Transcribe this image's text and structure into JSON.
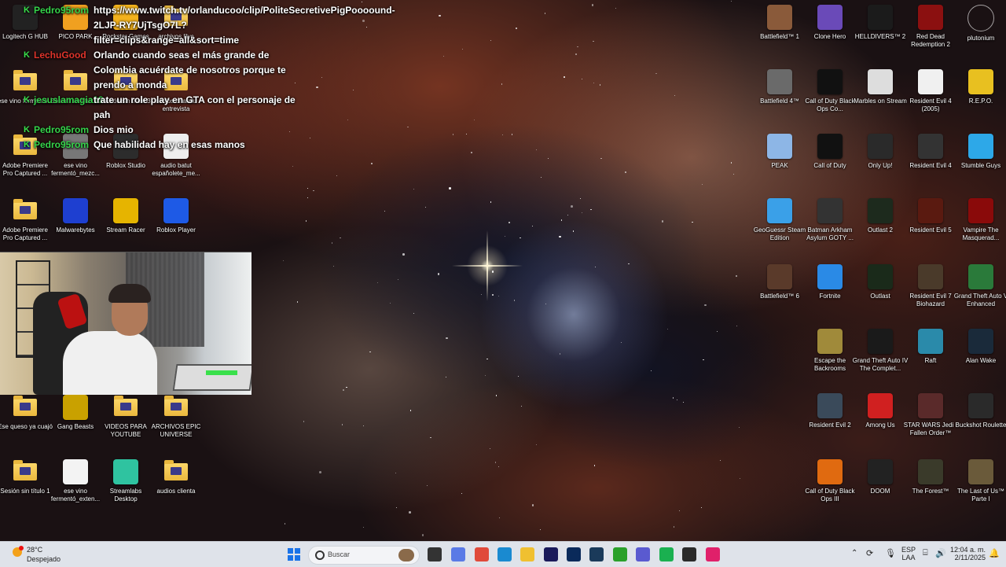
{
  "chat": [
    {
      "user": "Pedro95rom",
      "user_color": "#35d34a",
      "text": "https://www.twitch.tv/orlanducoo/clip/PoliteSecretivePigPoooound-2LJP-RY7UjTsgO7L?filter=clips&range=all&sort=time"
    },
    {
      "user": "LechuGood",
      "user_color": "#e0342b",
      "text": "Orlando cuando seas el más grande de Colombia acuérdate de nosotros porque te prendo a monda"
    },
    {
      "user": "jesuslamagia19",
      "user_color": "#35d34a",
      "text": "trate un role play en GTA con el personaje de pah"
    },
    {
      "user": "Pedro95rom",
      "user_color": "#35d34a",
      "text": "Dios mio"
    },
    {
      "user": "Pedro95rom",
      "user_color": "#35d34a",
      "text": "Que habilidad hay en esas manos"
    }
  ],
  "left_icons": [
    {
      "label": "Logitech G HUB",
      "color": "#222"
    },
    {
      "label": "PICO PARK",
      "color": "#f0a020"
    },
    {
      "label": "Rockstar Games",
      "color": "#f3b21d"
    },
    {
      "label": "archivos lilyc",
      "color": "folder"
    },
    {
      "label": "ese vino fermentó...",
      "color": "folder"
    },
    {
      "label": "Sesión sin título 2",
      "color": "folder"
    },
    {
      "label": "Sesión sin título 3",
      "color": "folder"
    },
    {
      "label": "audios orlandu entrevista",
      "color": "folder"
    },
    {
      "label": "Adobe Premiere Pro Captured ...",
      "color": "folder"
    },
    {
      "label": "ese vino fermentó_mezc...",
      "color": "#777"
    },
    {
      "label": "Roblox Studio",
      "color": "#2c2c2c"
    },
    {
      "label": "audio batut españolete_me...",
      "color": "#eee"
    },
    {
      "label": "Adobe Premiere Pro Captured ...",
      "color": "folder"
    },
    {
      "label": "Malwarebytes",
      "color": "#1e3fd0"
    },
    {
      "label": "Stream Racer",
      "color": "#e6b400"
    },
    {
      "label": "Roblox Player",
      "color": "#1e5ae6"
    },
    {
      "label": "Ese queso ya cuajó",
      "color": "folder"
    },
    {
      "label": "Gang Beasts",
      "color": "#c9a100"
    },
    {
      "label": "VIDEOS PARA YOUTUBE",
      "color": "folder"
    },
    {
      "label": "ARCHIVOS EPIC UNIVERSE",
      "color": "folder"
    },
    {
      "label": "Sesión sin título 1",
      "color": "folder"
    },
    {
      "label": "ese vino fermentó_exten...",
      "color": "#f3f3f3"
    },
    {
      "label": "Streamlabs Desktop",
      "color": "#2fc3a0"
    },
    {
      "label": "audios clienta",
      "color": "folder"
    }
  ],
  "right_icons": [
    {
      "label": "Battlefield™ 1",
      "color": "#8a5a3a"
    },
    {
      "label": "Clone Hero",
      "color": "#6a4ab8"
    },
    {
      "label": "HELLDIVERS™ 2",
      "color": "#1b1b1b"
    },
    {
      "label": "Red Dead Redemption 2",
      "color": "#8b1010"
    },
    {
      "label": "plutonium",
      "color": "transparent"
    },
    {
      "label": "Battlefield 4™",
      "color": "#6a6a6a"
    },
    {
      "label": "Call of Duty Black Ops Co...",
      "color": "#111"
    },
    {
      "label": "Marbles on Stream",
      "color": "#ddd"
    },
    {
      "label": "Resident Evil 4 (2005)",
      "color": "#f0f0f0"
    },
    {
      "label": "R.E.P.O.",
      "color": "#e8c020"
    },
    {
      "label": "PEAK",
      "color": "#8db6e6"
    },
    {
      "label": "Call of Duty",
      "color": "#111"
    },
    {
      "label": "Only Up!",
      "color": "#2a2a2a"
    },
    {
      "label": "Resident Evil 4",
      "color": "#333"
    },
    {
      "label": "Stumble Guys",
      "color": "#2da8e8"
    },
    {
      "label": "GeoGuessr Steam Edition",
      "color": "#3aa0e8"
    },
    {
      "label": "Batman Arkham Asylum GOTY ...",
      "color": "#333"
    },
    {
      "label": "Outlast 2",
      "color": "#1d2a1d"
    },
    {
      "label": "Resident Evil 5",
      "color": "#5a1a10"
    },
    {
      "label": "Vampire The Masquerad...",
      "color": "#8a0a0a"
    },
    {
      "label": "Battlefield™ 6",
      "color": "#5a3a2a"
    },
    {
      "label": "Fortnite",
      "color": "#2a8ae6"
    },
    {
      "label": "Outlast",
      "color": "#1a2a1a"
    },
    {
      "label": "Resident Evil 7 Biohazard",
      "color": "#4a3a2a"
    },
    {
      "label": "Grand Theft Auto V Enhanced",
      "color": "#2a7a3a"
    },
    {
      "label": "Escape the Backrooms",
      "color": "#a08a3a"
    },
    {
      "label": "Grand Theft Auto IV The Complet...",
      "color": "#1a1a1a"
    },
    {
      "label": "Raft",
      "color": "#2a8aaa"
    },
    {
      "label": "Alan Wake",
      "color": "#1a2a3a"
    },
    {
      "label": "Resident Evil 2",
      "color": "#3a4a5a"
    },
    {
      "label": "Among Us",
      "color": "#d02020"
    },
    {
      "label": "STAR WARS Jedi - Fallen Order™",
      "color": "#5a2a2a"
    },
    {
      "label": "Buckshot Roulette",
      "color": "#2a2a2a"
    },
    {
      "label": "Call of Duty Black Ops III",
      "color": "#e06a10"
    },
    {
      "label": "DOOM",
      "color": "#222"
    },
    {
      "label": "The Forest™",
      "color": "#3a3a2a"
    },
    {
      "label": "The Last of Us™ Parte I",
      "color": "#6a5a3a"
    }
  ],
  "taskbar": {
    "weather_temp": "28°C",
    "weather_desc": "Despejado",
    "search_placeholder": "Buscar",
    "language_line1": "ESP",
    "language_line2": "LAA",
    "time": "12:04 a. m.",
    "date": "2/11/2025",
    "apps": [
      {
        "name": "task-view",
        "color": "#333"
      },
      {
        "name": "copilot",
        "color": "#5a7ae6"
      },
      {
        "name": "chrome",
        "color": "#e04a3a"
      },
      {
        "name": "edge",
        "color": "#1a8ad0"
      },
      {
        "name": "file-explorer",
        "color": "#f0c030"
      },
      {
        "name": "premiere-pro",
        "color": "#1a1a5a"
      },
      {
        "name": "audition",
        "color": "#0a2a5a"
      },
      {
        "name": "steam",
        "color": "#1a3a5a"
      },
      {
        "name": "gamepass",
        "color": "#2aa02a"
      },
      {
        "name": "teams",
        "color": "#5a5ad0"
      },
      {
        "name": "spotify",
        "color": "#1ab050"
      },
      {
        "name": "obs",
        "color": "#2a2a2a"
      },
      {
        "name": "tiktok",
        "color": "#e0206a"
      }
    ]
  }
}
